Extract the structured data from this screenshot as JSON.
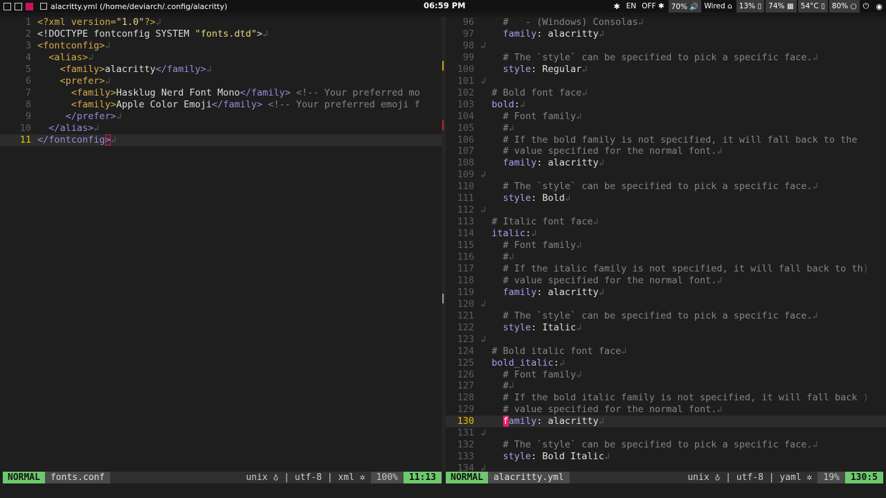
{
  "topbar": {
    "window_title": "alacritty.yml (/home/deviarch/.config/alacritty)",
    "clock": "06:59 PM",
    "tray": [
      {
        "id": "network-wireless",
        "icon": "wifi-icon",
        "text": "✱"
      },
      {
        "id": "keyboard-layout",
        "icon": "keyboard-icon",
        "text": "EN"
      },
      {
        "id": "bluetooth",
        "icon": "bluetooth-icon",
        "text": "OFF ✱"
      },
      {
        "id": "volume",
        "icon": "volume-icon",
        "text": "70% 🔊"
      },
      {
        "id": "network",
        "icon": "wired-icon",
        "text": "Wired ⌂"
      },
      {
        "id": "battery",
        "icon": "battery-icon",
        "text": "13% ▯"
      },
      {
        "id": "memory",
        "icon": "memory-icon",
        "text": "74% ▦"
      },
      {
        "id": "temperature",
        "icon": "thermometer-icon",
        "text": "54°C ▯"
      },
      {
        "id": "cpu",
        "icon": "cpu-icon",
        "text": "80% ○"
      },
      {
        "id": "power",
        "icon": "power-icon",
        "text": "⏻"
      },
      {
        "id": "discord",
        "icon": "discord-icon",
        "text": "◉"
      }
    ]
  },
  "left_editor": {
    "lines": [
      {
        "n": "1",
        "html": "<span class='xmldecl'>&lt;?xml version=</span><span class='str'>\"1.0\"</span><span class='xmldecl'>?&gt;</span><span class='eol'>↲</span>"
      },
      {
        "n": "2",
        "html": "<span class='txt'>&lt;!DOCTYPE fontconfig SYSTEM </span><span class='str'>\"fonts.dtd\"</span><span class='txt'>&gt;</span><span class='eol'>↲</span>"
      },
      {
        "n": "3",
        "html": "<span class='xmldecl'>&lt;fontconfig&gt;</span><span class='eol'>↲</span>"
      },
      {
        "n": "4",
        "html": "  <span class='xmldecl'>&lt;alias&gt;</span><span class='eol'>↲</span>"
      },
      {
        "n": "5",
        "html": "    <span class='xmldecl'>&lt;family&gt;</span><span class='txt'>alacritty</span><span class='tag'>&lt;/family&gt;</span><span class='eol'>↲</span>"
      },
      {
        "n": "6",
        "html": "    <span class='xmldecl'>&lt;prefer&gt;</span><span class='eol'>↲</span>"
      },
      {
        "n": "7",
        "html": "      <span class='xmldecl'>&lt;family&gt;</span><span class='txt'>Hasklug Nerd Font Mono</span><span class='tag'>&lt;/family&gt;</span> <span class='com'>&lt;!-- Your preferred mo</span>"
      },
      {
        "n": "8",
        "html": "      <span class='xmldecl'>&lt;family&gt;</span><span class='txt'>Apple Color Emoji</span><span class='tag'>&lt;/family&gt;</span> <span class='com'>&lt;!-- Your preferred emoji f</span>"
      },
      {
        "n": "9",
        "html": "     <span class='tag'>&lt;/prefer&gt;</span><span class='eol'>↲</span>"
      },
      {
        "n": "10",
        "html": "  <span class='tag'>&lt;/alias&gt;</span><span class='eol'>↲</span>"
      },
      {
        "n": "11",
        "cur": true,
        "html": "<span class='tag'>&lt;/fontconfig</span><span class='tag cursor-box'>&gt;</span><span class='eol'>↲</span>"
      }
    ],
    "status": {
      "mode": "NORMAL",
      "file": "fonts.conf",
      "info": "unix ♁ | utf-8 | xml ✲",
      "percent": "100%",
      "position": "11:13"
    }
  },
  "right_editor": {
    "lines": [
      {
        "n": "96",
        "html": "    <span class='com'>#   - (Windows) Consolas</span><span class='eol'>↲</span>"
      },
      {
        "n": "97",
        "html": "    <span class='key'>family</span><span class='val'>: alacritty</span><span class='eol'>↲</span>"
      },
      {
        "n": "98",
        "html": "<span class='eol'>↲</span>"
      },
      {
        "n": "99",
        "html": "    <span class='com'># The `style` can be specified to pick a specific face.</span><span class='eol'>↲</span>"
      },
      {
        "n": "100",
        "html": "    <span class='key'>style</span><span class='val'>: Regular</span><span class='eol'>↲</span>"
      },
      {
        "n": "101",
        "html": "<span class='eol'>↲</span>"
      },
      {
        "n": "102",
        "html": "  <span class='com'># Bold font face</span><span class='eol'>↲</span>"
      },
      {
        "n": "103",
        "html": "  <span class='key'>bold</span><span class='val'>:</span><span class='eol'>↲</span>"
      },
      {
        "n": "104",
        "html": "    <span class='com'># Font family</span><span class='eol'>↲</span>"
      },
      {
        "n": "105",
        "html": "    <span class='com'>#</span><span class='eol'>↲</span>"
      },
      {
        "n": "106",
        "html": "    <span class='com'># If the bold family is not specified, it will fall back to the</span>"
      },
      {
        "n": "107",
        "html": "    <span class='com'># value specified for the normal font.</span><span class='eol'>↲</span>"
      },
      {
        "n": "108",
        "html": "    <span class='key'>family</span><span class='val'>: alacritty</span><span class='eol'>↲</span>"
      },
      {
        "n": "109",
        "html": "<span class='eol'>↲</span>"
      },
      {
        "n": "110",
        "html": "    <span class='com'># The `style` can be specified to pick a specific face.</span><span class='eol'>↲</span>"
      },
      {
        "n": "111",
        "html": "    <span class='key'>style</span><span class='val'>: Bold</span><span class='eol'>↲</span>"
      },
      {
        "n": "112",
        "html": "<span class='eol'>↲</span>"
      },
      {
        "n": "113",
        "html": "  <span class='com'># Italic font face</span><span class='eol'>↲</span>"
      },
      {
        "n": "114",
        "html": "  <span class='key'>italic</span><span class='val'>:</span><span class='eol'>↲</span>"
      },
      {
        "n": "115",
        "html": "    <span class='com'># Font family</span><span class='eol'>↲</span>"
      },
      {
        "n": "116",
        "html": "    <span class='com'>#</span><span class='eol'>↲</span>"
      },
      {
        "n": "117",
        "html": "    <span class='com'># If the italic family is not specified, it will fall back to th</span><span class='eol'>⟩</span>"
      },
      {
        "n": "118",
        "html": "    <span class='com'># value specified for the normal font.</span><span class='eol'>↲</span>"
      },
      {
        "n": "119",
        "html": "    <span class='key'>family</span><span class='val'>: alacritty</span><span class='eol'>↲</span>"
      },
      {
        "n": "120",
        "html": "<span class='eol'>↲</span>"
      },
      {
        "n": "121",
        "html": "    <span class='com'># The `style` can be specified to pick a specific face.</span><span class='eol'>↲</span>"
      },
      {
        "n": "122",
        "html": "    <span class='key'>style</span><span class='val'>: Italic</span><span class='eol'>↲</span>"
      },
      {
        "n": "123",
        "html": "<span class='eol'>↲</span>"
      },
      {
        "n": "124",
        "html": "  <span class='com'># Bold italic font face</span><span class='eol'>↲</span>"
      },
      {
        "n": "125",
        "html": "  <span class='key'>bold_italic</span><span class='val'>:</span><span class='eol'>↲</span>"
      },
      {
        "n": "126",
        "html": "    <span class='com'># Font family</span><span class='eol'>↲</span>"
      },
      {
        "n": "127",
        "html": "    <span class='com'>#</span><span class='eol'>↲</span>"
      },
      {
        "n": "128",
        "html": "    <span class='com'># If the bold italic family is not specified, it will fall back </span><span class='eol'>⟩</span>"
      },
      {
        "n": "129",
        "html": "    <span class='com'># value specified for the normal font.</span><span class='eol'>↲</span>"
      },
      {
        "n": "130",
        "cur": true,
        "html": "    <span class='key cursor-fill'>f</span><span class='key'>amily</span><span class='val'>: alacritty</span><span class='eol'>↲</span>"
      },
      {
        "n": "131",
        "html": "<span class='eol'>↲</span>"
      },
      {
        "n": "132",
        "html": "    <span class='com'># The `style` can be specified to pick a specific face.</span><span class='eol'>↲</span>"
      },
      {
        "n": "133",
        "html": "    <span class='key'>style</span><span class='val'>: Bold Italic</span><span class='eol'>↲</span>"
      },
      {
        "n": "134",
        "html": "<span class='eol'>↲</span>"
      }
    ],
    "status": {
      "mode": "NORMAL",
      "file": "alacritty.yml",
      "info": "unix ♁ | utf-8 | yaml ✲",
      "percent": "19%",
      "position": "130:5"
    }
  },
  "colors": {
    "accent": "#c2185b",
    "mode_bg": "#6ec96e",
    "cursor_line": "#e6c200"
  }
}
